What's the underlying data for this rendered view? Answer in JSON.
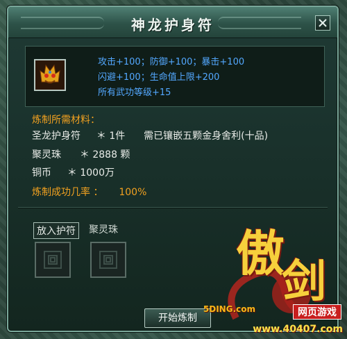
{
  "window": {
    "title": "神龙护身符"
  },
  "item": {
    "icon": "golden-dragon-head-icon",
    "attributes": {
      "line1": "攻击+100；防御+100；暴击+100",
      "line2": "闪避+100；生命值上限+200",
      "line3": "所有武功等级+15"
    }
  },
  "materials": {
    "header": "炼制所需材料：",
    "talisman": {
      "name": "圣龙护身符",
      "qty": "＊ 1件",
      "requirement": "需已镶嵌五颗金身舍利(十品)"
    },
    "pearl": {
      "name": "聚灵珠",
      "qty": "＊ 2888 颗"
    },
    "coins": {
      "name": "铜币",
      "qty": "＊ 1000万"
    },
    "success_rate": {
      "label": "炼制成功几率 ：",
      "value": "100%"
    }
  },
  "slots": {
    "talisman_label": "放入护符",
    "pearl_label": "聚灵珠"
  },
  "actions": {
    "start_label": "开始炼制"
  },
  "watermark": {
    "logo_char1": "傲",
    "logo_char2": "剑",
    "domain": "5DING.com",
    "badge": "网页游戏",
    "site": "www.40407.com"
  },
  "colors": {
    "attribute_text": "#53a8ff",
    "header_text": "#f0a020",
    "body_text": "#e9ece8"
  }
}
